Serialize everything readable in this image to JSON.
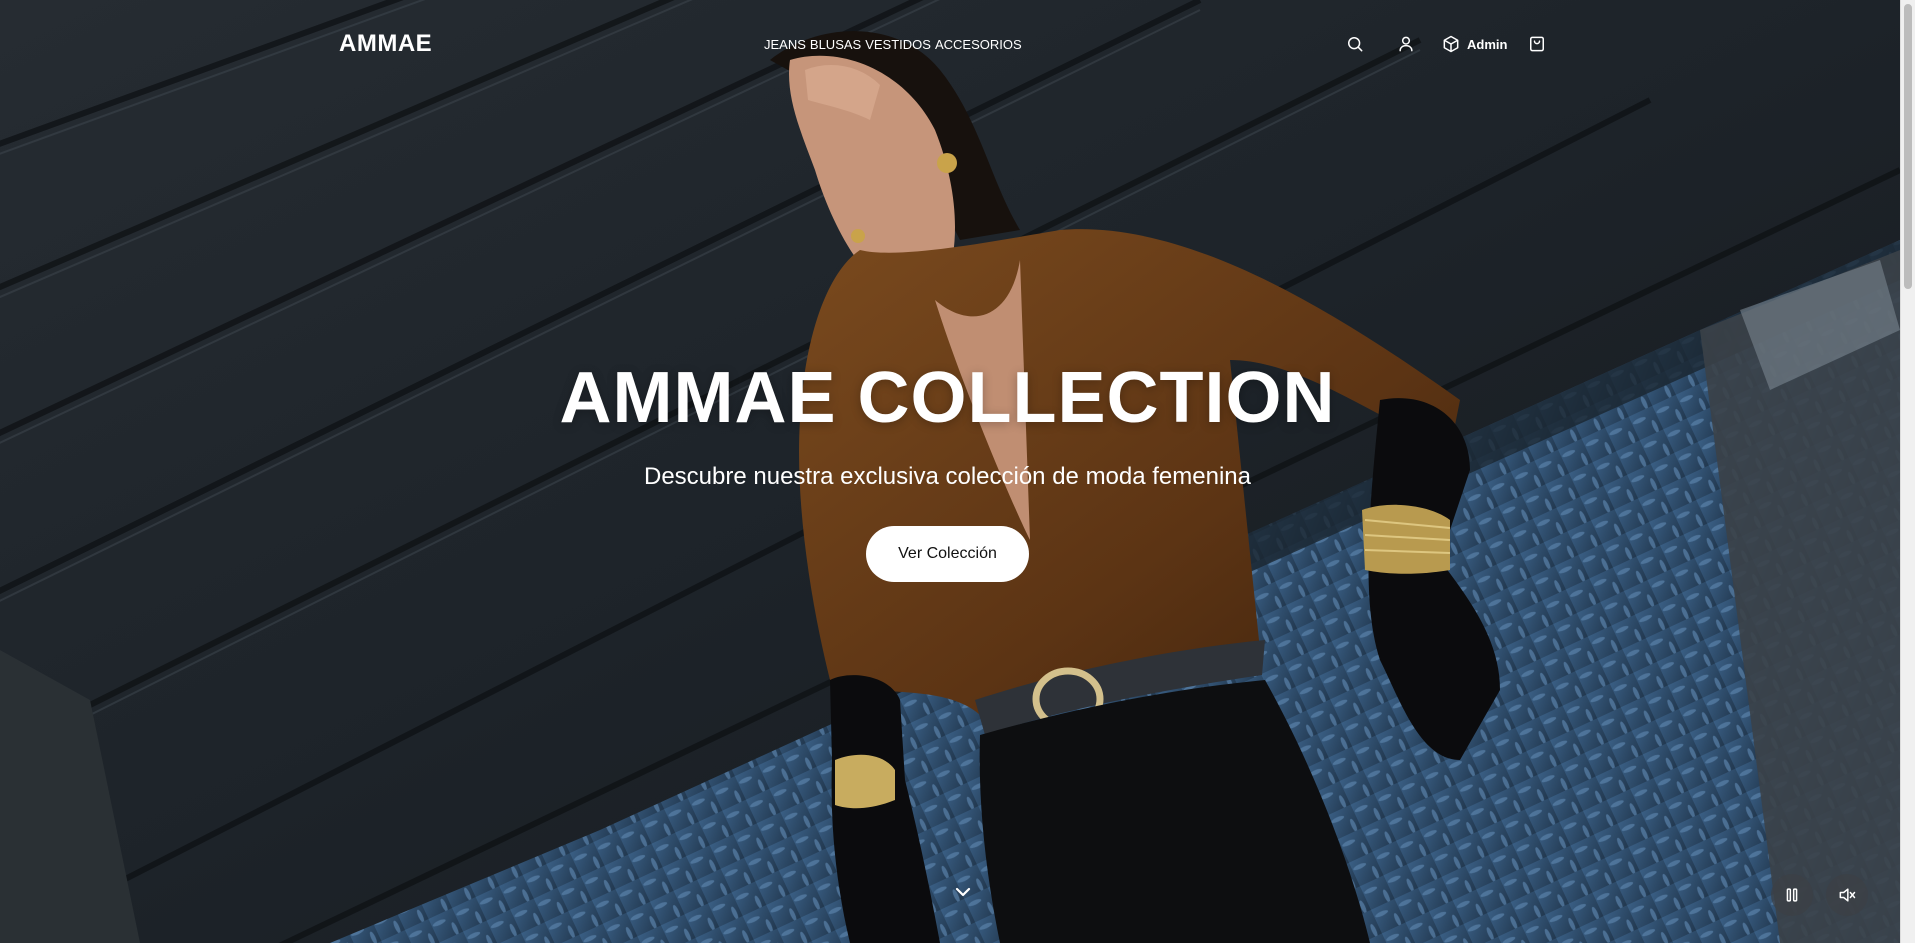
{
  "brand": {
    "logo": "AMMAE"
  },
  "nav": {
    "items": [
      {
        "label": "JEANS"
      },
      {
        "label": "BLUSAS"
      },
      {
        "label": "VESTIDOS"
      },
      {
        "label": "ACCESORIOS"
      }
    ]
  },
  "header_actions": {
    "search_icon": "search-icon",
    "account_icon": "user-icon",
    "admin_label": "Admin",
    "admin_icon": "box-icon",
    "cart_icon": "shopping-bag-icon"
  },
  "hero": {
    "title": "AMMAE COLLECTION",
    "subtitle": "Descubre nuestra exclusiva colección de moda femenina",
    "cta_label": "Ver Colección"
  },
  "controls": {
    "scroll_icon": "chevron-down-icon",
    "pause_icon": "pause-icon",
    "mute_icon": "volume-muted-icon"
  }
}
